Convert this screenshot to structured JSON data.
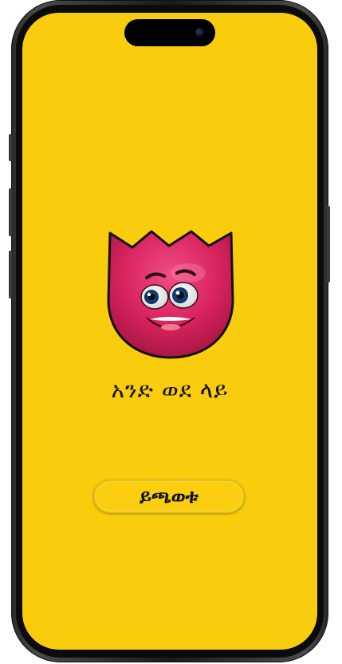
{
  "screen": {
    "background_color": "#f9cd0d",
    "mascot_icon": "red-tulip-face-mascot",
    "title": "አንድ ወደ ላይ",
    "play_button_label": "ይጫወቱ"
  },
  "device": {
    "frame": "phone",
    "camera_icon": "front-camera"
  }
}
